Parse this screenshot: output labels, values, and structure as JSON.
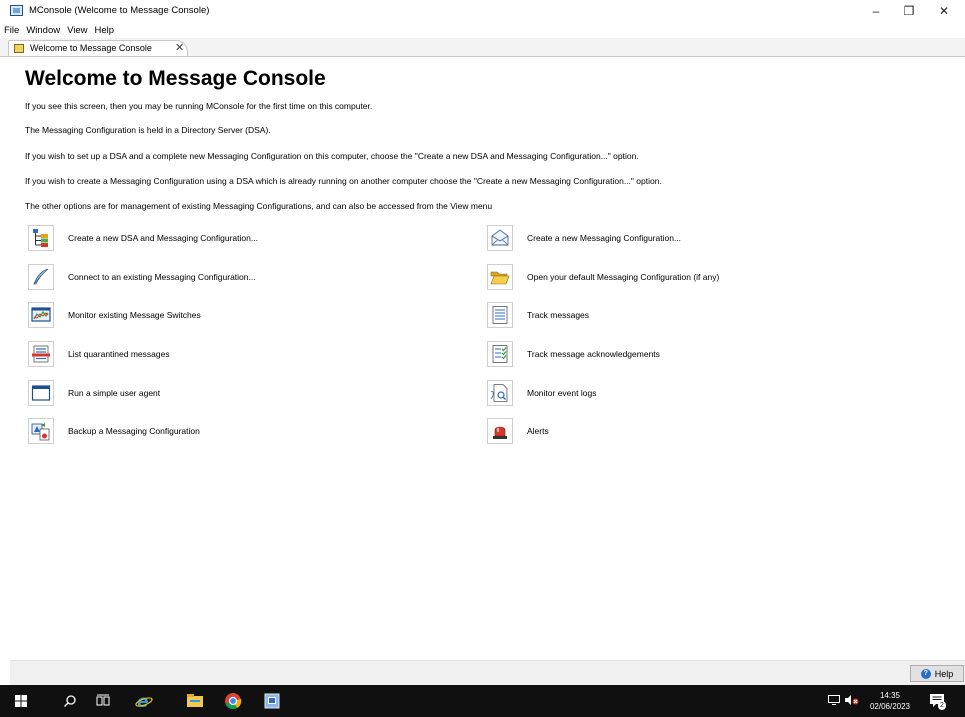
{
  "window": {
    "title": "MConsole (Welcome to Message Console)",
    "controls": {
      "minimize": "–",
      "maximize": "❐",
      "close": "✕"
    }
  },
  "menu": [
    "File",
    "Window",
    "View",
    "Help"
  ],
  "tab": {
    "label": "Welcome to Message Console",
    "close": "✕"
  },
  "content": {
    "title": "Welcome to Message Console",
    "paragraphs": [
      "If you see this screen, then you may be running MConsole for the first time on this computer.",
      "The Messaging Configuration is held in a Directory Server (DSA).",
      "If you wish to set up a DSA and a complete new Messaging Configuration on this computer, choose the \"Create a new DSA and Messaging Configuration...\" option.",
      "If you wish to create a Messaging Configuration using a DSA which is already running on another computer choose the \"Create a new Messaging Configuration...\" option.",
      "The other options are for management of existing Messaging Configurations, and can also be accessed from the View menu"
    ],
    "options_left": [
      {
        "label": "Create a new DSA and Messaging Configuration...",
        "icon": "tree-hierarchy-icon"
      },
      {
        "label": "Connect to an existing Messaging Configuration...",
        "icon": "feather-pen-icon"
      },
      {
        "label": "Monitor existing Message Switches",
        "icon": "monitor-graph-icon"
      },
      {
        "label": "List quarantined messages",
        "icon": "quarantine-list-icon"
      },
      {
        "label": "Run a simple user agent",
        "icon": "window-icon"
      },
      {
        "label": "Backup a Messaging Configuration",
        "icon": "backup-icon"
      }
    ],
    "options_right": [
      {
        "label": "Create a new Messaging Configuration...",
        "icon": "envelope-icon"
      },
      {
        "label": "Open your default Messaging Configuration (if any)",
        "icon": "folder-open-icon"
      },
      {
        "label": "Track messages",
        "icon": "document-lines-icon"
      },
      {
        "label": "Track message acknowledgements",
        "icon": "checklist-icon"
      },
      {
        "label": "Monitor event logs",
        "icon": "document-search-icon"
      },
      {
        "label": "Alerts",
        "icon": "alarm-light-icon"
      }
    ]
  },
  "help_button": {
    "label": "Help"
  },
  "taskbar": {
    "time": "14:35",
    "date": "02/06/2023",
    "notification_count": "2"
  },
  "colors": {
    "taskbar": "#101010",
    "accent_blue": "#2b6cc4",
    "bottom_bar": "#f0f0f0"
  }
}
